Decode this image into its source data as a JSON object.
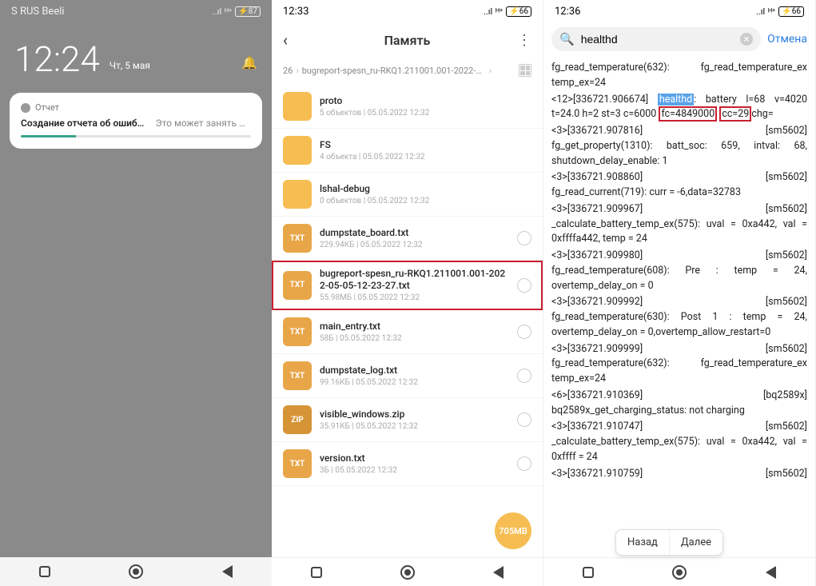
{
  "phone1": {
    "status": {
      "carrier": "S RUS   Beeli",
      "battery": "87"
    },
    "time": "12:24",
    "date": "Чт, 5 мая",
    "notif": {
      "app": "Отчет",
      "title": "Создание отчета об ошибке...",
      "sub": "Это может занять не..."
    }
  },
  "phone2": {
    "status": {
      "time": "12:33",
      "battery": "66"
    },
    "title": "Память",
    "crumb": {
      "a": "26",
      "b": "bugreport-spesn_ru-RKQ1.211001.001-2022-05-05-12-23-27"
    },
    "files": [
      {
        "type": "folder",
        "name": "proto",
        "meta": "5 объектов | 05.05.2022 12:32",
        "radio": false
      },
      {
        "type": "folder",
        "name": "FS",
        "meta": "4 объекта | 05.05.2022 12:32",
        "radio": false
      },
      {
        "type": "folder",
        "name": "lshal-debug",
        "meta": "0 объектов | 05.05.2022 12:32",
        "radio": false
      },
      {
        "type": "txt",
        "label": "TXT",
        "name": "dumpstate_board.txt",
        "meta": "229.94КБ | 05.05.2022 12:32",
        "radio": true
      },
      {
        "type": "txt",
        "label": "TXT",
        "name": "bugreport-spesn_ru-RKQ1.211001.001-2022-05-05-12-23-27.txt",
        "meta": "55.98МБ | 05.05.2022 12:32",
        "radio": true,
        "hl": true
      },
      {
        "type": "txt",
        "label": "TXT",
        "name": "main_entry.txt",
        "meta": "58Б | 05.05.2022 12:32",
        "radio": true
      },
      {
        "type": "txt",
        "label": "TXT",
        "name": "dumpstate_log.txt",
        "meta": "99.16КБ | 05.05.2022 12:32",
        "radio": true
      },
      {
        "type": "zip",
        "label": "ZIP",
        "name": "visible_windows.zip",
        "meta": "35.91КБ | 05.05.2022 12:32",
        "radio": true
      },
      {
        "type": "txt",
        "label": "TXT",
        "name": "version.txt",
        "meta": "3Б | 05.05.2022 12:32",
        "radio": true
      }
    ],
    "fab": "705MB"
  },
  "phone3": {
    "status": {
      "time": "12:36",
      "battery": "66"
    },
    "search": {
      "value": "healthd"
    },
    "cancel": "Отмена",
    "popup": {
      "prev": "Назад",
      "next": "Далее"
    },
    "log": {
      "l1": "fg_read_temperature(632): fg_read_temperature_ex temp_ex=24",
      "l2a": "<12>[336721.906674]",
      "l2b": "healthd",
      "l2c": ": battery l=68 v=4020 t=24.0 h=2 st=3 c=6000 ",
      "l2d": "fc=4849000",
      "l2e": "cc=29",
      "l2f": "chg=",
      "l3a": "<3>[336721.907816]",
      "l3b": "[sm5602]",
      "l3c": "fg_get_property(1310): batt_soc: 659, intval: 68, shutdown_delay_enable: 1",
      "l4a": "<3>[336721.908860]",
      "l4b": "[sm5602]",
      "l4c": "fg_read_current(719): curr = -6,data=32783",
      "l5a": "<3>[336721.909967]",
      "l5b": "[sm5602]",
      "l5c": "_calculate_battery_temp_ex(575): uval = 0xa442, val = 0xffffa442, temp = 24",
      "l6a": "<3>[336721.909980]",
      "l6b": "[sm5602]",
      "l6c": "fg_read_temperature(608): Pre : temp = 24, overtemp_delay_on = 0",
      "l7a": "<3>[336721.909992]",
      "l7b": "[sm5602]",
      "l7c": "fg_read_temperature(630): Post 1 : temp = 24, overtemp_delay_on = 0,overtemp_allow_restart=0",
      "l8a": "<3>[336721.909999]",
      "l8b": "[sm5602]",
      "l8c": "fg_read_temperature(632): fg_read_temperature_ex temp_ex=24",
      "l9a": "<6>[336721.910369]",
      "l9b": "[bq2589x]",
      "l9c": "bq2589x_get_charging_status: not charging",
      "l10a": "<3>[336721.910747]",
      "l10b": "[sm5602]",
      "l10c": "_calculate_battery_temp_ex(575): uval = 0xa442, val = 0xffff",
      "l10d": " = 24",
      "l11a": "<3>[336721.910759]",
      "l11b": "[sm5602]"
    }
  }
}
